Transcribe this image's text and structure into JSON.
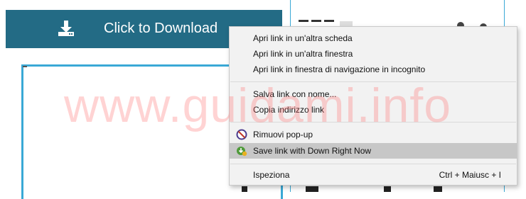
{
  "download_button": {
    "label": "Click to Download",
    "icon": "download-icon",
    "color": "#236b85"
  },
  "watermark": {
    "text": "www.guidami.info"
  },
  "context_menu": {
    "items": [
      {
        "label": "Apri link in un'altra scheda"
      },
      {
        "label": "Apri link in un'altra finestra"
      },
      {
        "label": "Apri link in finestra di navigazione in incognito"
      },
      {
        "label": "Salva link con nome..."
      },
      {
        "label": "Copia indirizzo link"
      },
      {
        "label": "Rimuovi pop-up",
        "icon": "block-icon"
      },
      {
        "label": "Save link with Down Right Now",
        "icon": "down-right-now-icon",
        "highlighted": true
      },
      {
        "label": "Ispeziona",
        "shortcut": "Ctrl + Maiusc + I"
      }
    ]
  },
  "colors": {
    "accent": "#236b85",
    "frame_border": "#3aa9d6",
    "menu_highlight": "#c7c7c7"
  }
}
